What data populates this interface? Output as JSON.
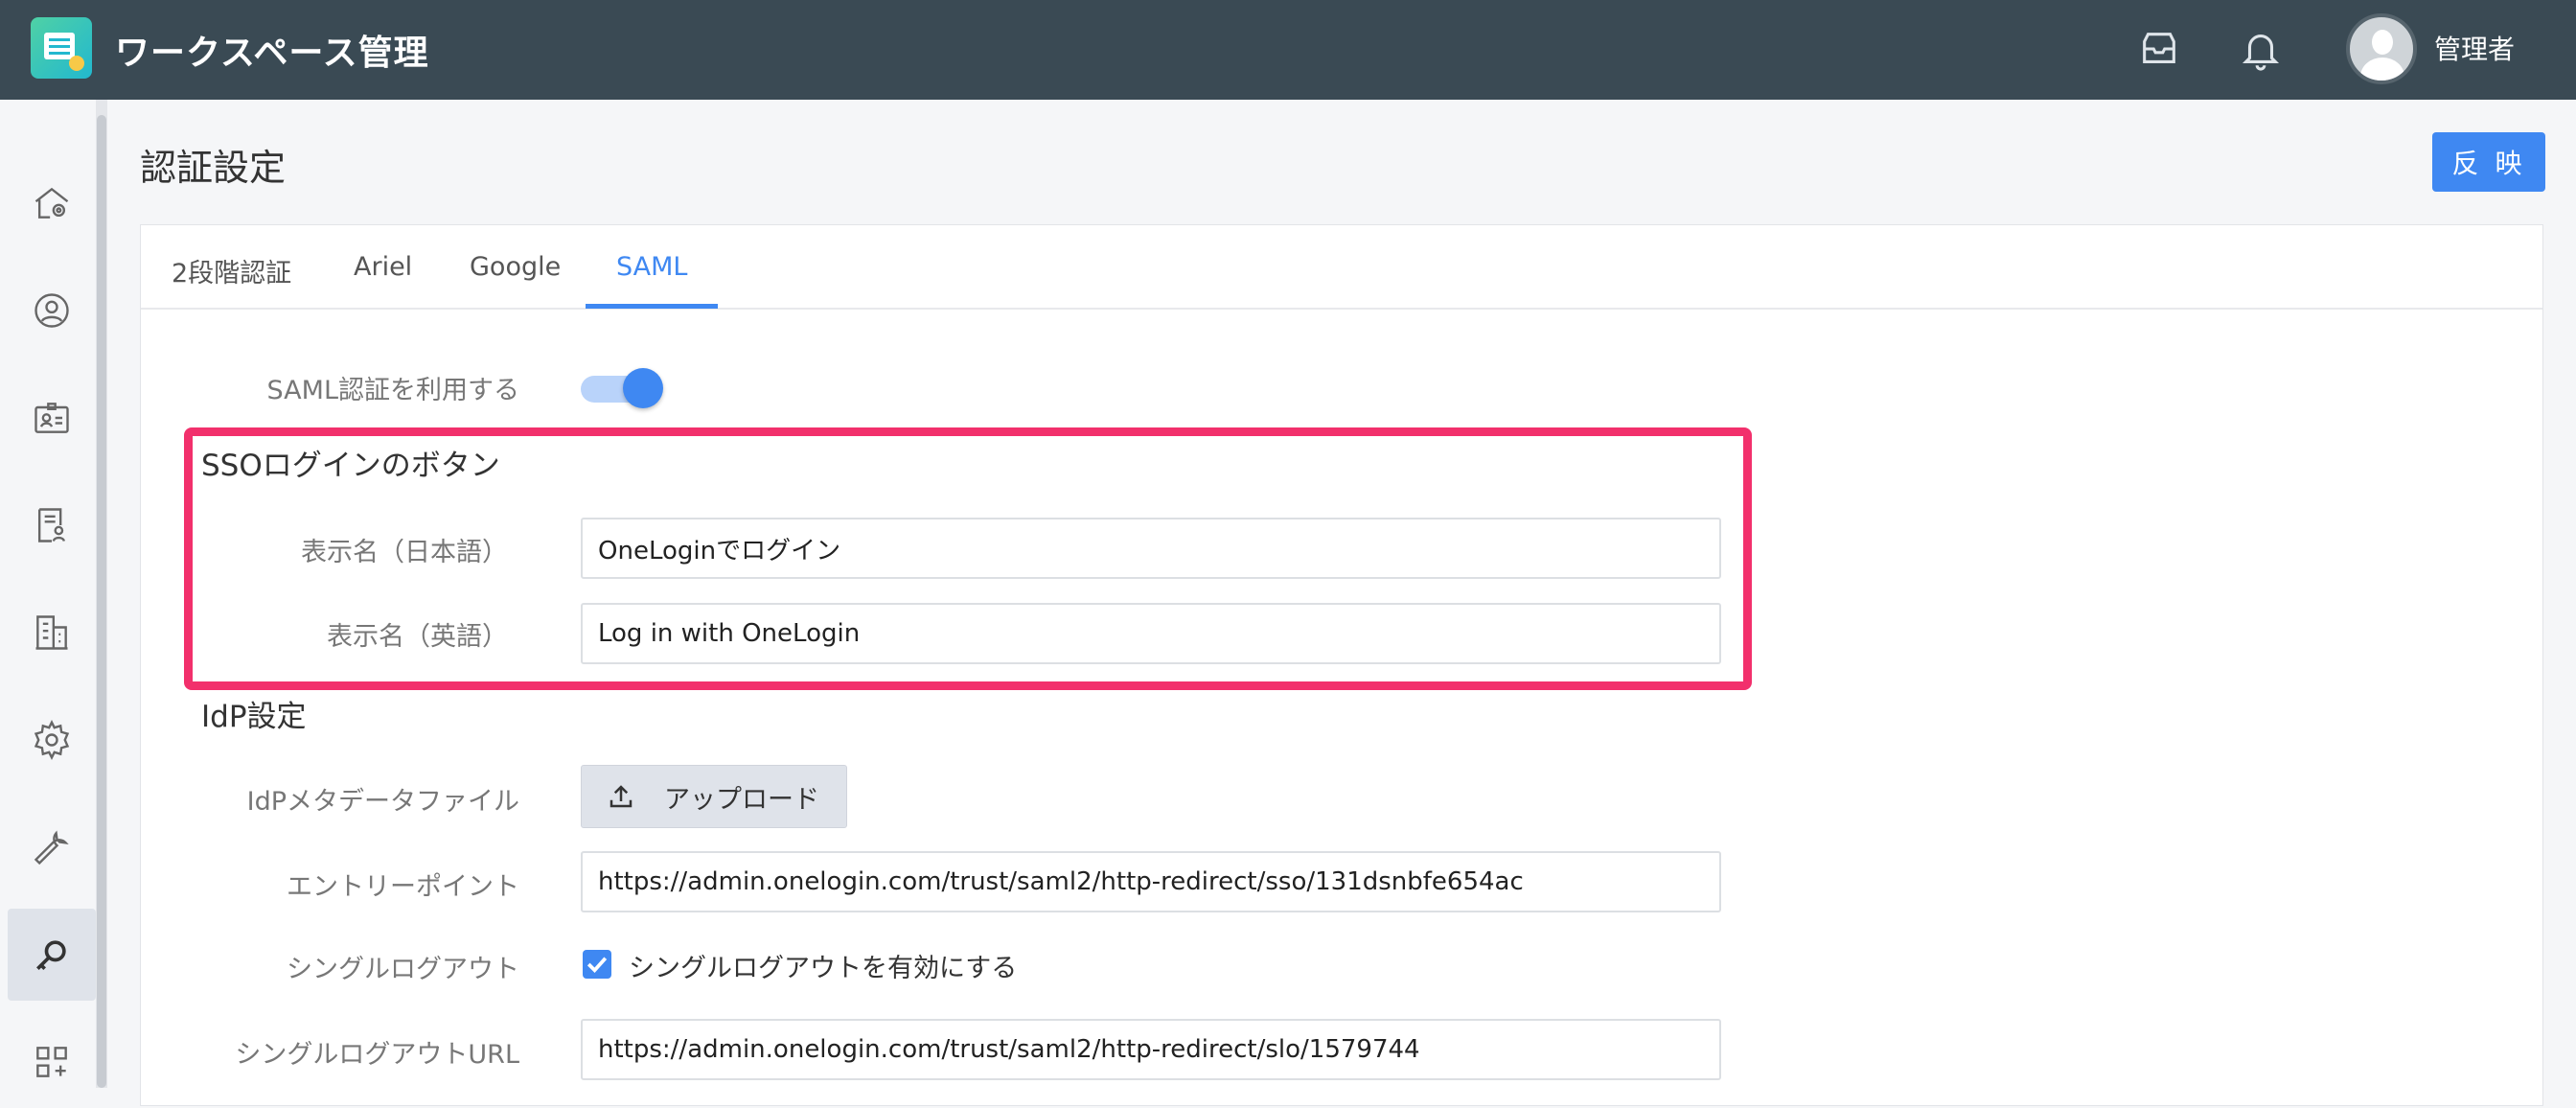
{
  "header": {
    "app_title": "ワークスペース管理",
    "user_name": "管理者"
  },
  "page": {
    "title": "認証設定",
    "apply_label": "反 映"
  },
  "tabs": [
    {
      "label": "2段階認証",
      "active": false
    },
    {
      "label": "Ariel",
      "active": false
    },
    {
      "label": "Google",
      "active": false
    },
    {
      "label": "SAML",
      "active": true
    }
  ],
  "sidebar": {
    "items": [
      {
        "icon": "home-settings-icon",
        "active": false
      },
      {
        "icon": "user-circle-icon",
        "active": false
      },
      {
        "icon": "id-card-icon",
        "active": false
      },
      {
        "icon": "document-user-icon",
        "active": false
      },
      {
        "icon": "building-icon",
        "active": false
      },
      {
        "icon": "gear-icon",
        "active": false
      },
      {
        "icon": "wrench-icon",
        "active": false
      },
      {
        "icon": "key-search-icon",
        "active": true
      },
      {
        "icon": "apps-add-icon",
        "active": false
      }
    ]
  },
  "saml": {
    "enable_label": "SAML認証を利用する",
    "enabled": true,
    "sso_section_title": "SSOログインのボタン",
    "display_name_ja_label": "表示名（日本語）",
    "display_name_ja_value": "OneLoginでログイン",
    "display_name_en_label": "表示名（英語）",
    "display_name_en_value": "Log in with OneLogin",
    "idp_section_title": "IdP設定",
    "metadata_label": "IdPメタデータファイル",
    "upload_label": "アップロード",
    "entry_point_label": "エントリーポイント",
    "entry_point_value": "https://admin.onelogin.com/trust/saml2/http-redirect/sso/131dsnbfe654ac",
    "single_logout_label": "シングルログアウト",
    "single_logout_checkbox_label": "シングルログアウトを有効にする",
    "single_logout_checked": true,
    "single_logout_url_label": "シングルログアウトURL",
    "single_logout_url_value": "https://admin.onelogin.com/trust/saml2/http-redirect/slo/1579744"
  },
  "colors": {
    "topbar": "#3a4a54",
    "accent": "#3f88f2",
    "highlight": "#f2306c"
  }
}
